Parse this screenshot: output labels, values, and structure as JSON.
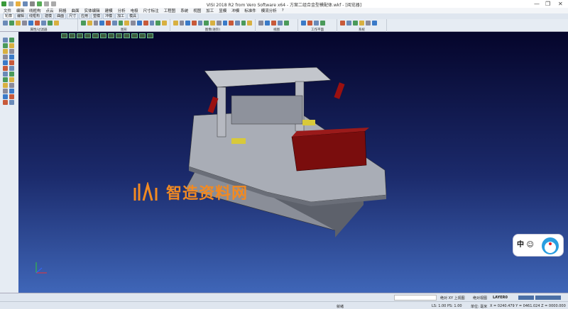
{
  "window": {
    "title": "VISI 2018 R2 from Vero Software x64 - 方案二组合金型模配体.wkf - [阅览器]",
    "minimize": "—",
    "maximize": "❐",
    "close": "✕"
  },
  "menu": [
    "文件",
    "编辑",
    "线框构",
    "点云",
    "网格",
    "曲面",
    "实体编辑",
    "建模",
    "分析",
    "电极",
    "尺寸标注",
    "工程图",
    "系统",
    "视图",
    "加工",
    "显模",
    "冲模",
    "标准件",
    "模流分析",
    "?"
  ],
  "ribbon_tabs": [
    "轮廓",
    "编辑",
    "线框构",
    "建模",
    "曲面",
    "尺寸",
    "应用",
    "塑模",
    "冲模",
    "加工",
    "模具"
  ],
  "ribbon_groups": [
    "属性/过滤器",
    "图形",
    "图像(进阶)",
    "视图",
    "工作平面",
    "系统"
  ],
  "watermark": {
    "text": "智造资料网",
    "color": "#f28a22"
  },
  "mascot": {
    "text": "中 ☺"
  },
  "status": {
    "view": "绝对 XY 上视图",
    "view2": "绝对视图",
    "layer": "LAYER0",
    "ready": "就绪",
    "scale": "LS: 1.00 PS: 1.00",
    "unit": "单位: 毫米",
    "coords": "X = 0240.479 Y = 0461.024 Z = 0000.000"
  },
  "colors": {
    "viewport_top": "#05052b",
    "viewport_bottom": "#3f66b8",
    "block": "#7a0d0d"
  }
}
